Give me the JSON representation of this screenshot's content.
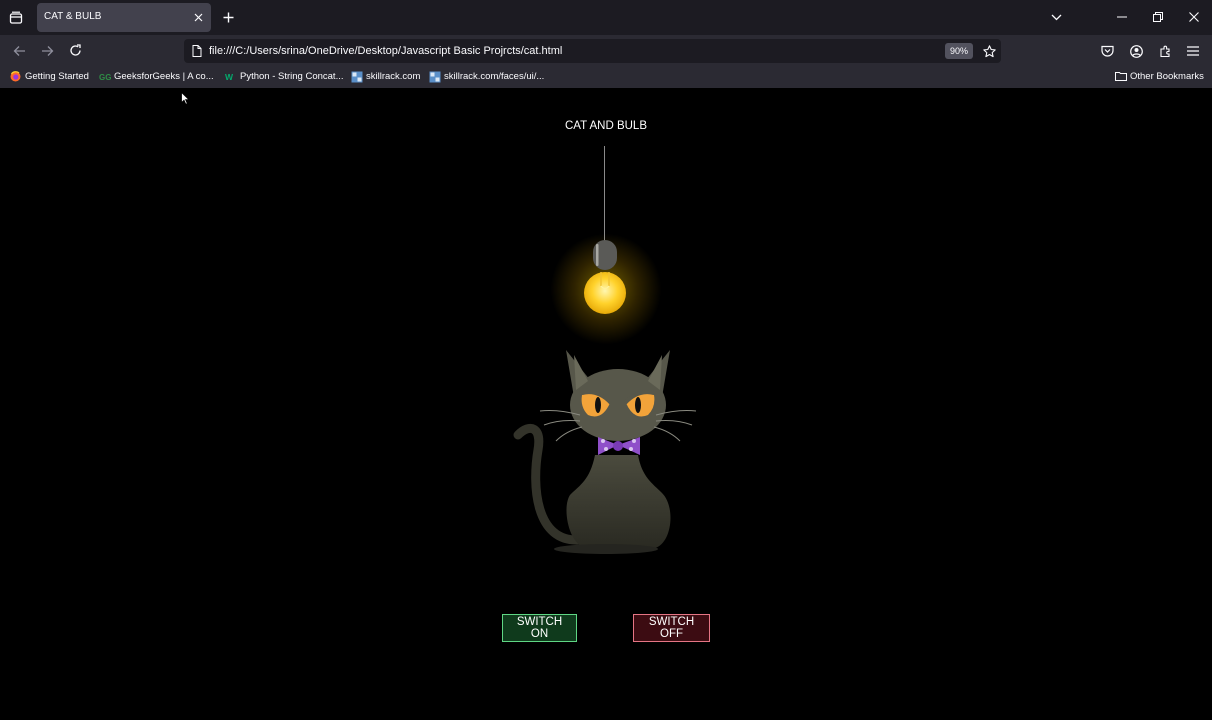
{
  "browser": {
    "tab": {
      "title": "CAT & BULB"
    },
    "url": "file:///C:/Users/srina/OneDrive/Desktop/Javascript Basic Projrcts/cat.html",
    "zoom": "90%",
    "bookmarks": [
      {
        "label": "Getting Started",
        "icon": "firefox-icon"
      },
      {
        "label": "GeeksforGeeks | A co...",
        "icon": "geeksforgeeks-icon"
      },
      {
        "label": "Python - String Concat...",
        "icon": "w3-icon"
      },
      {
        "label": "skillrack.com",
        "icon": "skillrack-icon"
      },
      {
        "label": "skillrack.com/faces/ui/...",
        "icon": "skillrack-icon"
      }
    ],
    "other_bookmarks": "Other Bookmarks"
  },
  "page": {
    "title": "CAT AND BULB",
    "switch_on": "SWITCH ON",
    "switch_off": "SWITCH OFF"
  },
  "colors": {
    "bulb": "#ffd22b",
    "cat_body": "#3e3e33",
    "cat_eyes": "#f2a33a",
    "bowtie": "#8f4fc9",
    "switch_on_border": "#5fd684",
    "switch_off_border": "#e57584"
  }
}
